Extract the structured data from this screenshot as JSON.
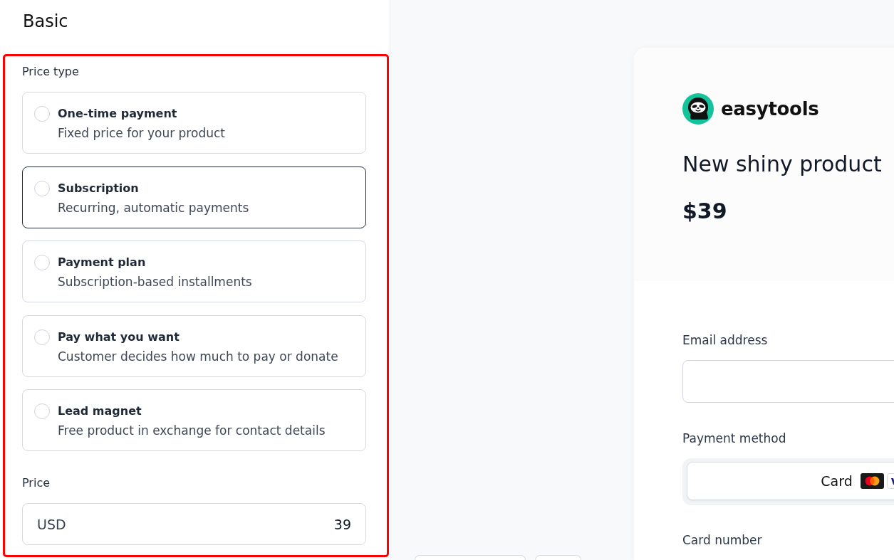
{
  "editor": {
    "heading": "Basic"
  },
  "price_section": {
    "highlighted": true,
    "label": "Price type",
    "options": [
      {
        "title": "One-time payment",
        "description": "Fixed price for your product",
        "selected": false,
        "focused": false
      },
      {
        "title": "Subscription",
        "description": "Recurring, automatic payments",
        "selected": false,
        "focused": true
      },
      {
        "title": "Payment plan",
        "description": "Subscription-based installments",
        "selected": false,
        "focused": false
      },
      {
        "title": "Pay what you want",
        "description": "Customer decides how much to pay or donate",
        "selected": false,
        "focused": false
      },
      {
        "title": "Lead magnet",
        "description": "Free product in exchange for contact details",
        "selected": false,
        "focused": false
      }
    ],
    "price": {
      "label": "Price",
      "currency": "USD",
      "value": "39"
    }
  },
  "bottom_buttons": [
    {
      "kind": "wide"
    },
    {
      "kind": "narrow"
    }
  ],
  "preview": {
    "brand": "easytools",
    "product": "New shiny product",
    "price": "$39",
    "email": {
      "label": "Email address"
    },
    "payment_method": {
      "label": "Payment method",
      "options": [
        {
          "label": "Card",
          "selected": true
        }
      ]
    },
    "card_number": {
      "label": "Card number"
    }
  }
}
